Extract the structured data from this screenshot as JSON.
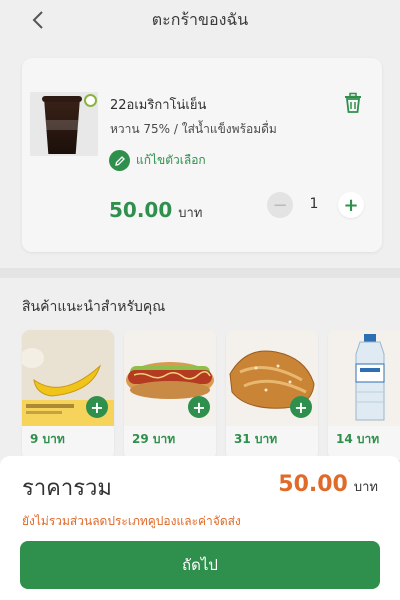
{
  "header": {
    "title": "ตะกร้าของฉัน",
    "back_icon": "chevron-left-icon"
  },
  "cart_item": {
    "name": "22อเมริกาโน่เย็น",
    "options": "หวาน 75% / ใส่น้ำแข็งพร้อมดื่ม",
    "edit_label": "แก้ไขตัวเลือก",
    "price": "50.00",
    "price_unit": "บาท",
    "quantity": "1",
    "minus_label": "−",
    "plus_label": "+",
    "delete_icon": "trash-icon"
  },
  "recommended": {
    "title": "สินค้าแนะนำสำหรับคุณ",
    "items": [
      {
        "price": "9 บาท",
        "add_label": "+"
      },
      {
        "price": "29 บาท",
        "add_label": "+"
      },
      {
        "price": "31 บาท",
        "add_label": "+"
      },
      {
        "price": "14 บาท",
        "add_label": "+"
      }
    ]
  },
  "summary": {
    "total_label": "ราคารวม",
    "total_value": "50.00",
    "total_unit": "บาท",
    "note": "ยังไม่รวมส่วนลดประเภทคูปองและค่าจัดส่ง",
    "next_label": "ถัดไป"
  },
  "colors": {
    "accent_green": "#2f8f4c",
    "accent_orange": "#e06a2a",
    "background": "#efefef"
  }
}
